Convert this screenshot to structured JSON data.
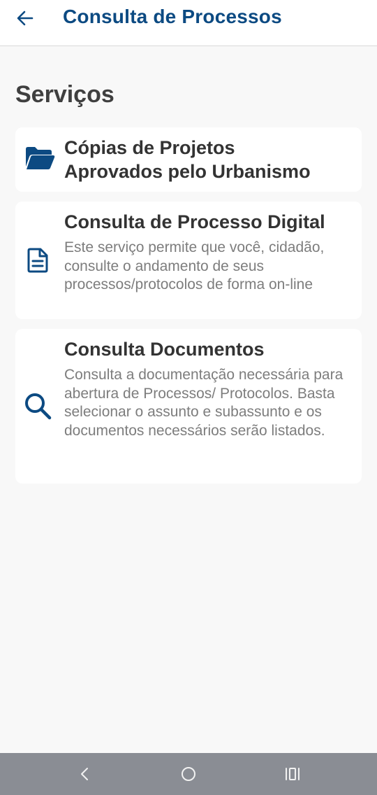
{
  "appbar": {
    "title": "Consulta de Processos"
  },
  "section": {
    "title": "Serviços"
  },
  "services": [
    {
      "title_line1": "Cópias de Projetos",
      "title_line2": "Aprovados pelo Urbanismo",
      "icon": "folder-open-icon"
    },
    {
      "title": "Consulta de Processo Digital",
      "description": "Este serviço permite que você, cidadão, consulte o andamento de seus processos/protocolos de forma on-line",
      "icon": "document-icon"
    },
    {
      "title": "Consulta Documentos",
      "description": "Consulta a documentação necessária para abertura de Processos/ Protocolos. Basta selecionar o assunto e subassunto e os documentos necessários serão listados.",
      "icon": "search-icon"
    }
  ],
  "navbar": {
    "icons": [
      "back-icon",
      "home-icon",
      "recent-apps-icon"
    ]
  },
  "colors": {
    "primary": "#0c4a82",
    "background": "#f8f8f8",
    "card": "#ffffff",
    "title_text": "#333333",
    "description_text": "#7d7d7d",
    "navbar": "#8a8d94"
  }
}
